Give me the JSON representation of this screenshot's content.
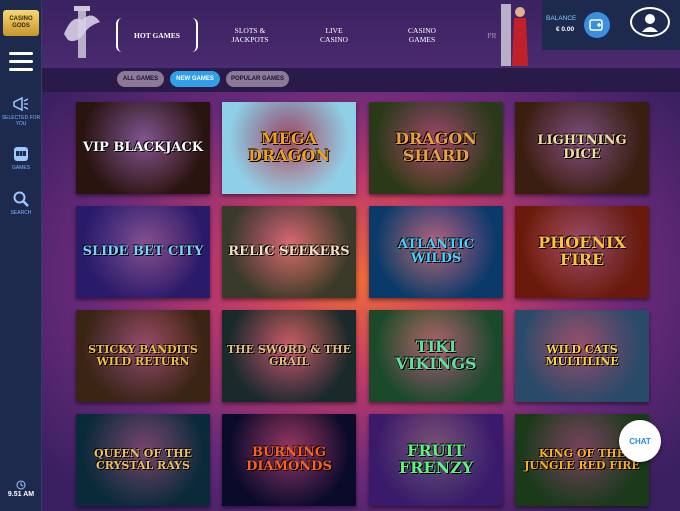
{
  "brand": {
    "logo_text": "CASINO GODS"
  },
  "sidebar": {
    "items": [
      {
        "label": "Selected for you",
        "icon": "megaphone-icon"
      },
      {
        "label": "Games",
        "icon": "slot-machine-icon"
      },
      {
        "label": "Search",
        "icon": "search-icon"
      }
    ],
    "clock": "9.51 AM"
  },
  "nav": {
    "tabs": [
      {
        "label": "Hot Games",
        "active": true
      },
      {
        "label": "Slots & Jackpots",
        "active": false
      },
      {
        "label": "Live Casino",
        "active": false
      },
      {
        "label": "Casino Games",
        "active": false
      },
      {
        "label": "Pr",
        "active": false
      }
    ]
  },
  "account": {
    "balance_label": "Balance",
    "balance_value": "€ 0.00"
  },
  "filters": [
    {
      "label": "All Games",
      "active": false
    },
    {
      "label": "New Games",
      "active": true
    },
    {
      "label": "Popular Games",
      "active": false
    }
  ],
  "games": [
    {
      "title": "VIP Blackjack",
      "bg": "#2a1410",
      "fg": "#ffffff"
    },
    {
      "title": "Mega Dragon",
      "bg": "#8fd0e8",
      "fg": "#f0a020"
    },
    {
      "title": "Dragon Shard",
      "bg": "#2a3a18",
      "fg": "#e8a040"
    },
    {
      "title": "Lightning Dice",
      "bg": "#3a1e10",
      "fg": "#f0e0a0"
    },
    {
      "title": "Slide Bet City",
      "bg": "#2a1a6a",
      "fg": "#7ad0ff"
    },
    {
      "title": "Relic Seekers",
      "bg": "#3a3a2a",
      "fg": "#f0e0c0"
    },
    {
      "title": "Atlantic Wilds",
      "bg": "#0a3a6a",
      "fg": "#4ad0ff"
    },
    {
      "title": "Phoenix Fire",
      "bg": "#6a1a0a",
      "fg": "#ffc040"
    },
    {
      "title": "Sticky Bandits Wild Return",
      "bg": "#3a2414",
      "fg": "#f0c040"
    },
    {
      "title": "The Sword & the Grail",
      "bg": "#1a2a2a",
      "fg": "#e0c080"
    },
    {
      "title": "Tiki Vikings",
      "bg": "#1a4a2a",
      "fg": "#60e0a0"
    },
    {
      "title": "Wild Cats Multiline",
      "bg": "#2a4a6a",
      "fg": "#ffd040"
    },
    {
      "title": "Queen of the Crystal Rays",
      "bg": "#0a2a3a",
      "fg": "#f0c060"
    },
    {
      "title": "Burning Diamonds",
      "bg": "#0a0a2a",
      "fg": "#ff6020"
    },
    {
      "title": "Fruit Frenzy",
      "bg": "#3a1a6a",
      "fg": "#60f080"
    },
    {
      "title": "King of the Jungle Red Fire",
      "bg": "#1a3a1a",
      "fg": "#ffb020"
    }
  ],
  "chat": {
    "label": "CHAT"
  }
}
